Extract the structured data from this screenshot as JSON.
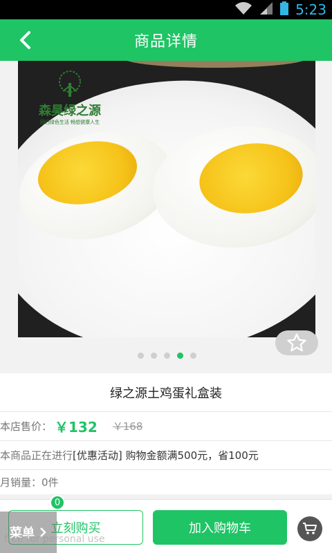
{
  "status_bar": {
    "time": "5:23"
  },
  "header": {
    "title": "商品详情"
  },
  "product_image": {
    "logo_brand": "森昊绿之源",
    "logo_slogan": "回归绿色生活 畅想健康人生"
  },
  "carousel": {
    "count": 5,
    "active_index": 3
  },
  "product": {
    "name": "绿之源土鸡蛋礼盒装",
    "price_label": "本店售价：",
    "price": "￥132",
    "original_price": "￥168",
    "promo_prefix": "本商品正在进行",
    "promo_text": "[优惠活动] 购物金额满500元，省100元",
    "monthly_sales": "月销量：0件"
  },
  "bottom_bar": {
    "buy_now_label": "立刻购买",
    "add_to_cart_label": "加入购物车",
    "cart_badge": "0",
    "menu_label": "菜单"
  },
  "watermark": "free for personal use",
  "colors": {
    "accent": "#1fc465",
    "status_time": "#33b5e5"
  }
}
